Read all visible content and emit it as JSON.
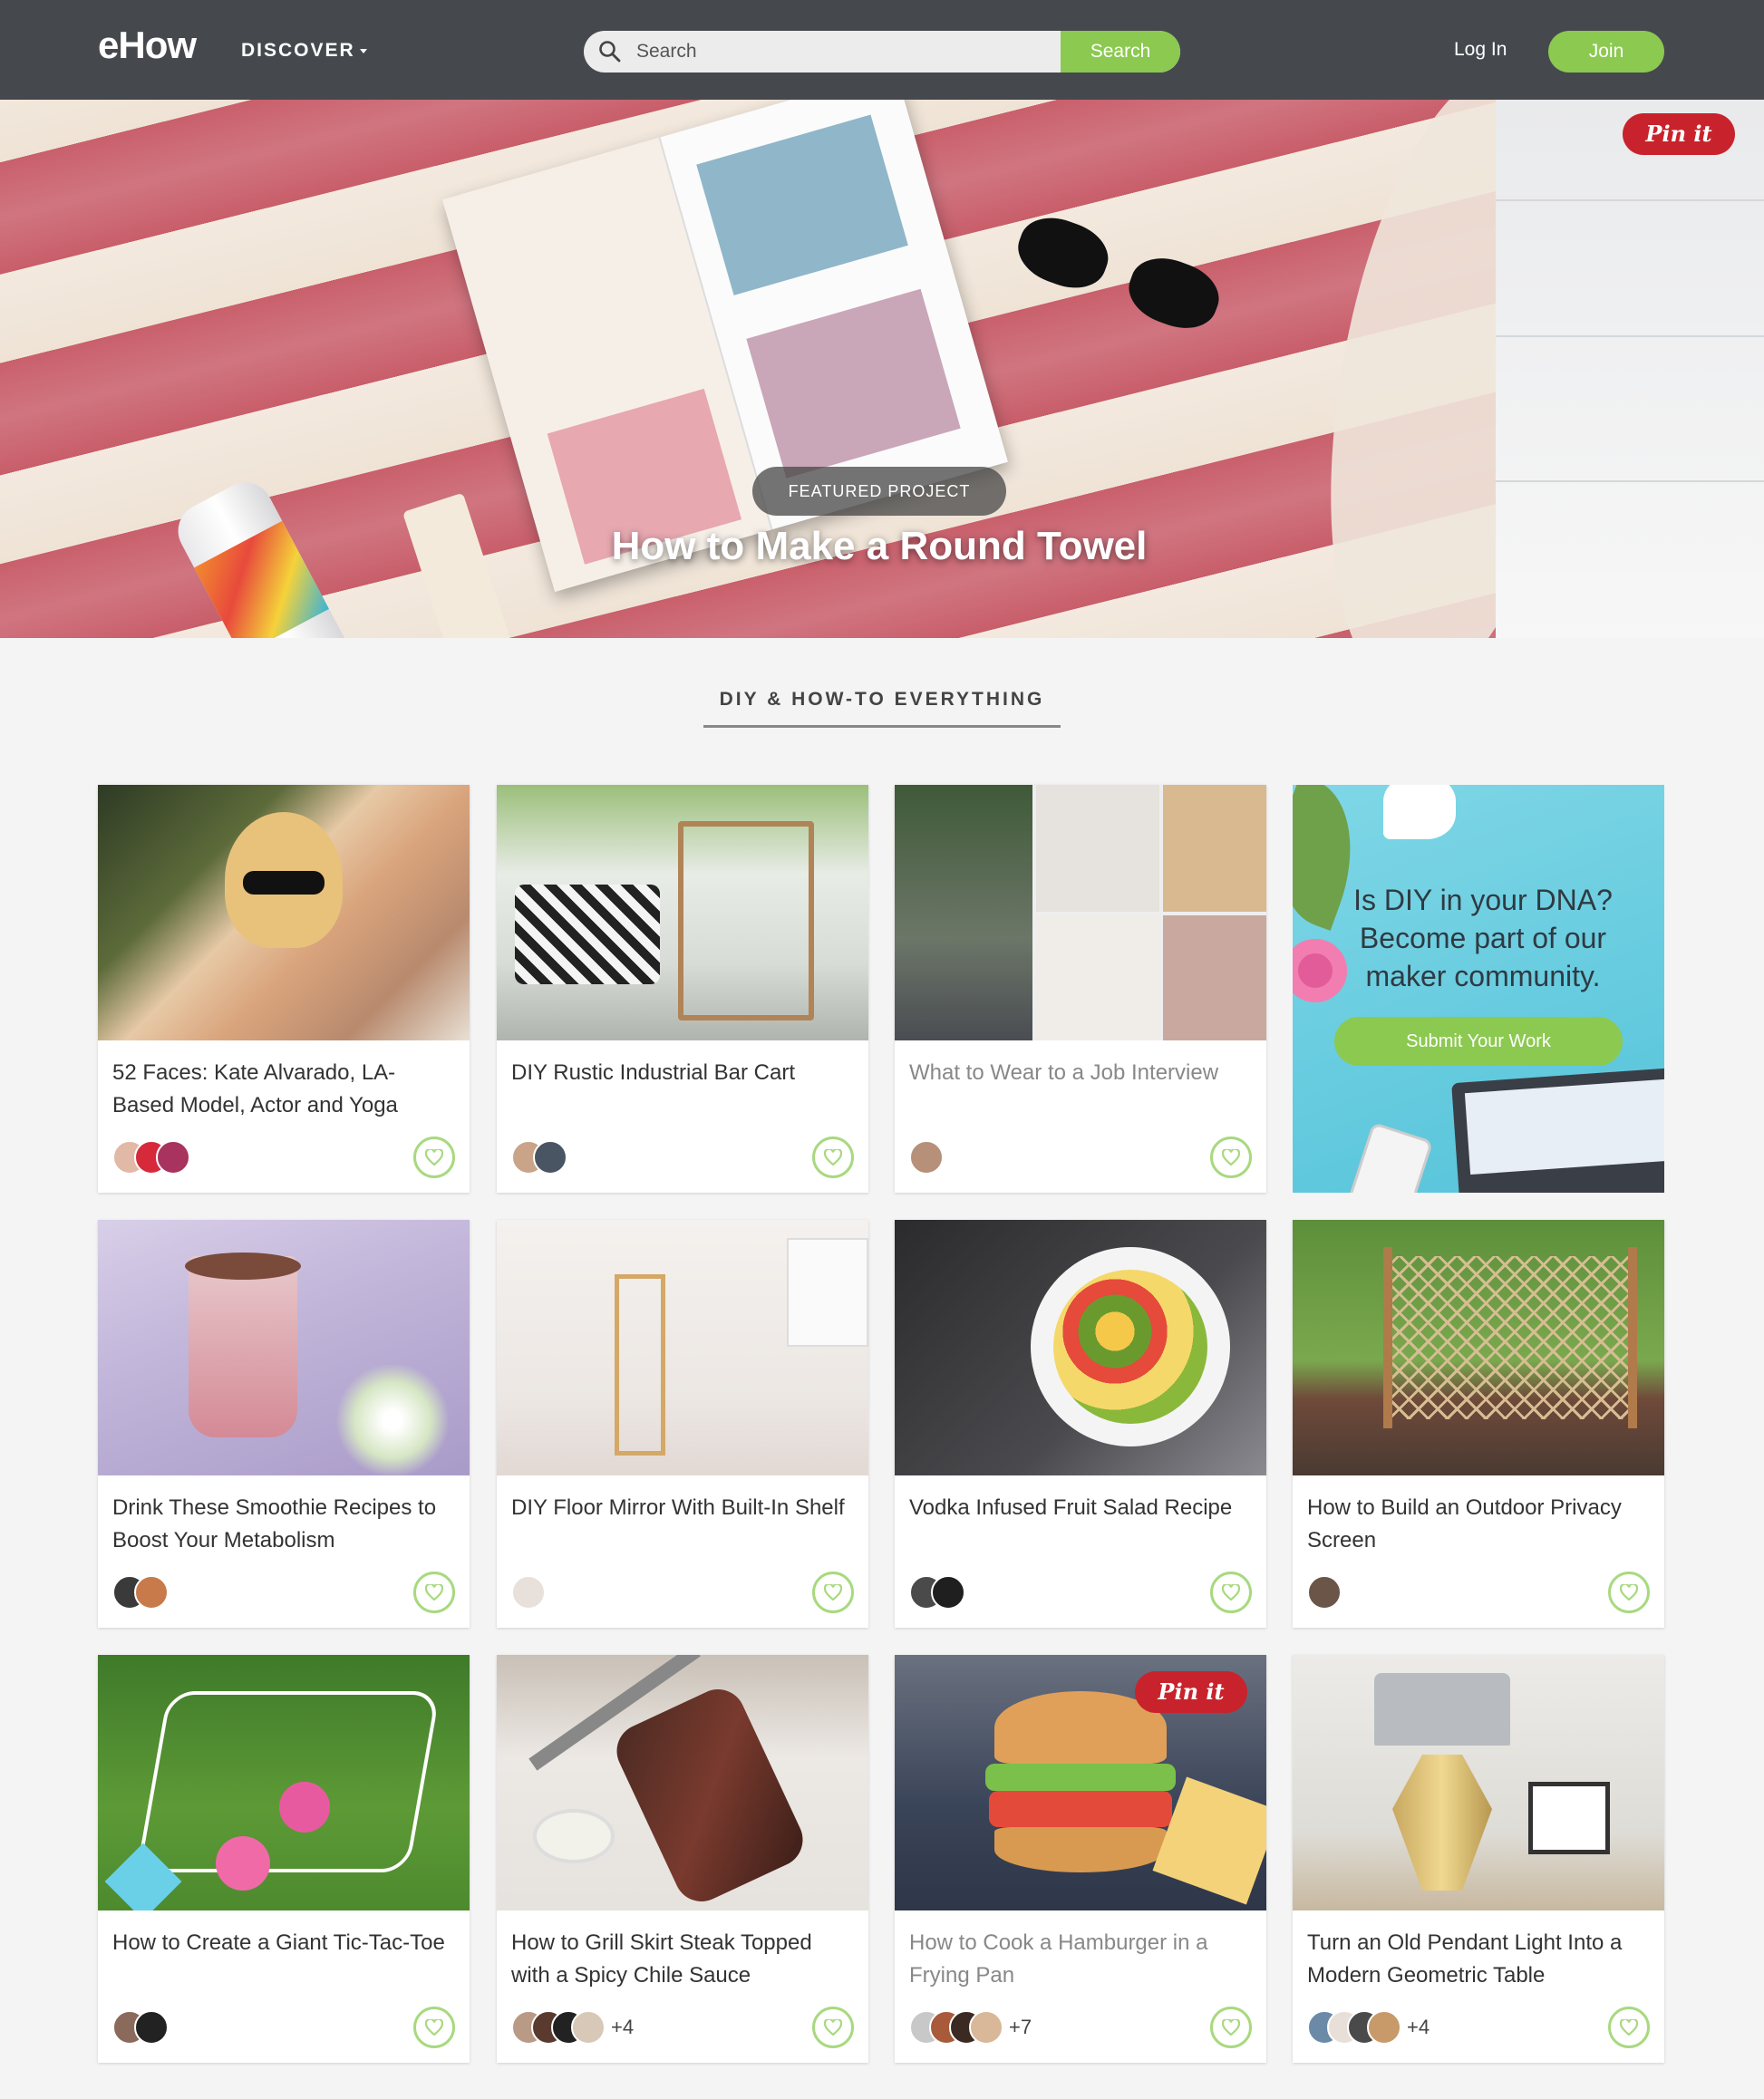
{
  "nav": {
    "logo": "eHow",
    "discover_label": "DISCOVER",
    "search_placeholder": "Search",
    "search_button": "Search",
    "login_label": "Log In",
    "join_label": "Join"
  },
  "hero": {
    "pin_label": "Pin it",
    "badge": "FEATURED PROJECT",
    "title": "How to Make a Round Towel"
  },
  "section": {
    "heading": "DIY & HOW-TO EVERYTHING"
  },
  "promo": {
    "text": "Is DIY in your DNA? Become part of our maker community.",
    "button": "Submit Your Work"
  },
  "cards": [
    {
      "title": "52 Faces: Kate Alvarado, LA-Based Model, Actor and Yoga",
      "extra": "",
      "muted": false
    },
    {
      "title": "DIY Rustic Industrial Bar Cart",
      "extra": "",
      "muted": false
    },
    {
      "title": "What to Wear to a Job Interview",
      "extra": "",
      "muted": true
    },
    {
      "title": "Drink These Smoothie Recipes to Boost Your Metabolism",
      "extra": "",
      "muted": false
    },
    {
      "title": "DIY Floor Mirror With Built-In Shelf",
      "extra": "",
      "muted": false
    },
    {
      "title": "Vodka Infused Fruit Salad Recipe",
      "extra": "",
      "muted": false
    },
    {
      "title": "How to Build an Outdoor Privacy Screen",
      "extra": "",
      "muted": false
    },
    {
      "title": "How to Create a Giant Tic-Tac-Toe",
      "extra": "",
      "muted": false
    },
    {
      "title": "How to Grill Skirt Steak Topped with a Spicy Chile Sauce",
      "extra": "+4",
      "muted": false
    },
    {
      "title": "How to Cook a Hamburger in a Frying Pan",
      "extra": "+7",
      "muted": true
    },
    {
      "title": "Turn an Old Pendant Light Into a Modern Geometric Table",
      "extra": "+4",
      "muted": false
    }
  ],
  "card_pin_label": "Pin it",
  "colors": {
    "nav_bg": "#45494e",
    "accent_green": "#8cc950",
    "pin_red": "#c8232c",
    "heart_ring": "#a8d97f"
  },
  "icons": [
    "search-icon",
    "caret-down-icon",
    "heart-icon",
    "pinterest-pin-icon"
  ]
}
